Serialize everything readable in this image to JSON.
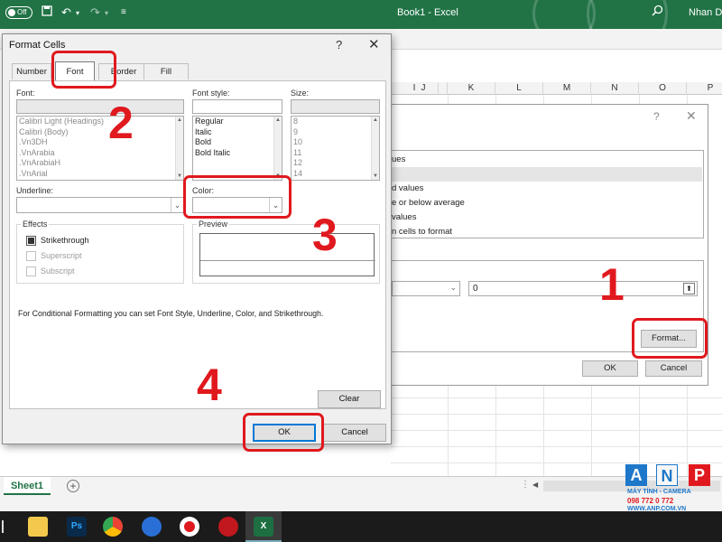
{
  "titlebar": {
    "autosave": "Off",
    "title": "Book1  -  Excel",
    "user": "Nhan Da",
    "icons": [
      "save-icon",
      "undo-icon",
      "redo-icon",
      "customize-icon",
      "search-icon"
    ]
  },
  "sheet": {
    "columns": [
      "I",
      "J",
      "K",
      "L",
      "M",
      "N",
      "O",
      "P"
    ],
    "tab": "Sheet1"
  },
  "cf_dialog": {
    "help": "?",
    "close": "✕",
    "rule_items": [
      "ues",
      "",
      "d values",
      "e or below average",
      "values",
      "n cells to format"
    ],
    "selected_index": 1,
    "value": "0",
    "format_button": "Format...",
    "ok": "OK",
    "cancel": "Cancel"
  },
  "format_cells": {
    "title": "Format Cells",
    "help": "?",
    "close": "✕",
    "tabs": [
      "Number",
      "Font",
      "Border",
      "Fill"
    ],
    "active_tab": "Font",
    "font_label": "Font:",
    "fonts": [
      "Calibri Light (Headings)",
      "Calibri (Body)",
      ".Vn3DH",
      ".VnArabia",
      ".VnArabiaH",
      ".VnArial"
    ],
    "font_style_label": "Font style:",
    "font_styles": [
      "Regular",
      "Italic",
      "Bold",
      "Bold Italic"
    ],
    "size_label": "Size:",
    "sizes": [
      "8",
      "9",
      "10",
      "11",
      "12",
      "14"
    ],
    "underline_label": "Underline:",
    "color_label": "Color:",
    "effects_label": "Effects",
    "strikethrough": "Strikethrough",
    "superscript": "Superscript",
    "subscript": "Subscript",
    "preview_label": "Preview",
    "note": "For Conditional Formatting you can set Font Style, Underline, Color, and Strikethrough.",
    "clear": "Clear",
    "ok": "OK",
    "cancel": "Cancel"
  },
  "annotations": {
    "step1": "1",
    "step2": "2",
    "step3": "3",
    "step4": "4"
  },
  "watermark": {
    "letters": [
      "A",
      "N",
      "P"
    ],
    "line1": "MÁY TÍNH - CAMERA",
    "line2": "098 772 0 772",
    "line3": "WWW.ANP.COM.VN"
  },
  "taskbar": {
    "apps": [
      "file-explorer-icon",
      "photoshop-icon",
      "chrome-icon",
      "anydesk-icon",
      "record-icon",
      "garena-icon",
      "excel-icon"
    ],
    "ps_label": "Ps"
  },
  "colors": {
    "excel_green": "#217346",
    "annotation_red": "#e0191e",
    "focus_blue": "#0078d7"
  }
}
